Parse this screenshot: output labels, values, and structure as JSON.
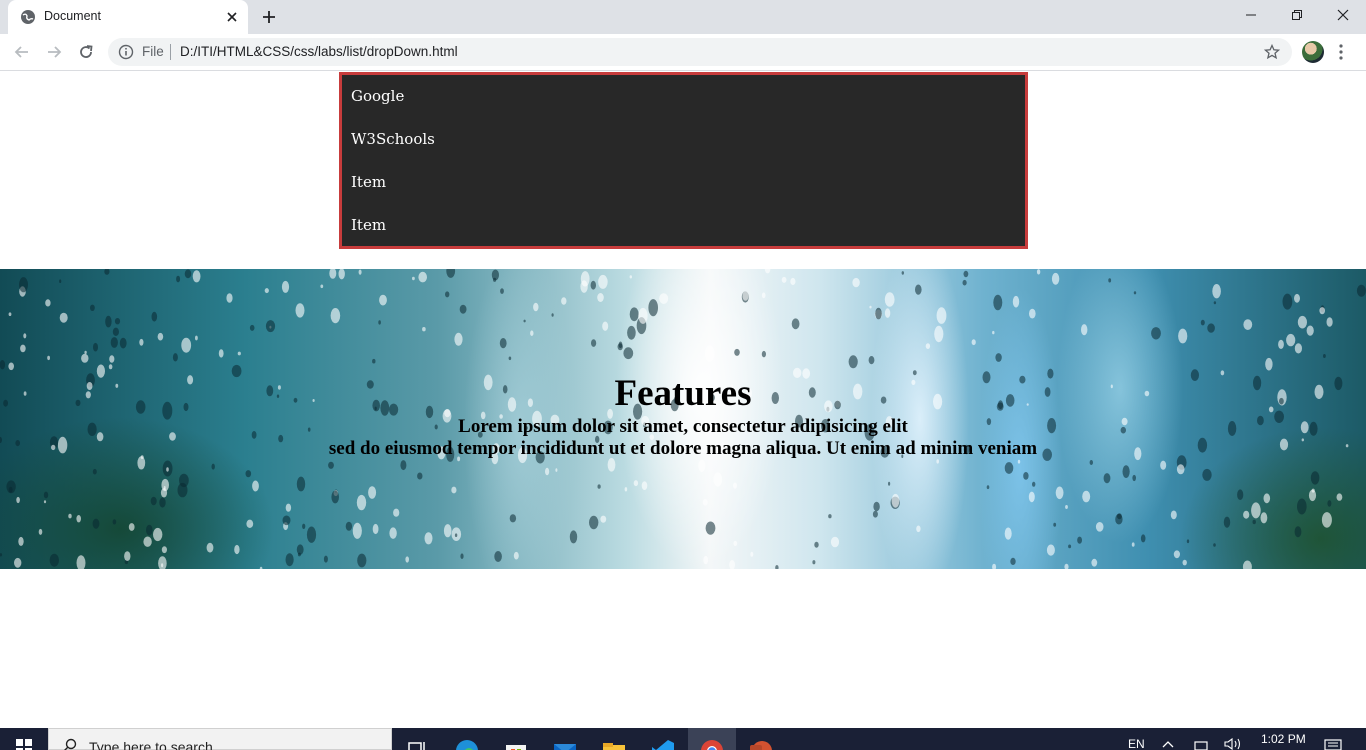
{
  "browser": {
    "tab_title": "Document",
    "omnibox_scheme": "File",
    "url": "D:/ITI/HTML&CSS/css/labs/list/dropDown.html"
  },
  "page": {
    "dropdown_items": [
      "Google",
      "W3Schools",
      "Item",
      "Item"
    ],
    "hero": {
      "title": "Features",
      "line1": "Lorem ipsum dolor sit amet, consectetur adipisicing elit",
      "line2": "sed do eiusmod tempor incididunt ut et dolore magna aliqua. Ut enim ad minim veniam"
    },
    "colors": {
      "dropdown_bg": "#282828",
      "dropdown_border": "#c73c3c"
    }
  },
  "taskbar": {
    "search_placeholder": "Type here to search",
    "language": "EN",
    "time": "1:02 PM",
    "apps": [
      "task-view-icon",
      "edge-icon",
      "store-icon",
      "mail-icon",
      "file-explorer-icon",
      "vscode-icon",
      "chrome-icon",
      "powerpoint-icon"
    ]
  }
}
